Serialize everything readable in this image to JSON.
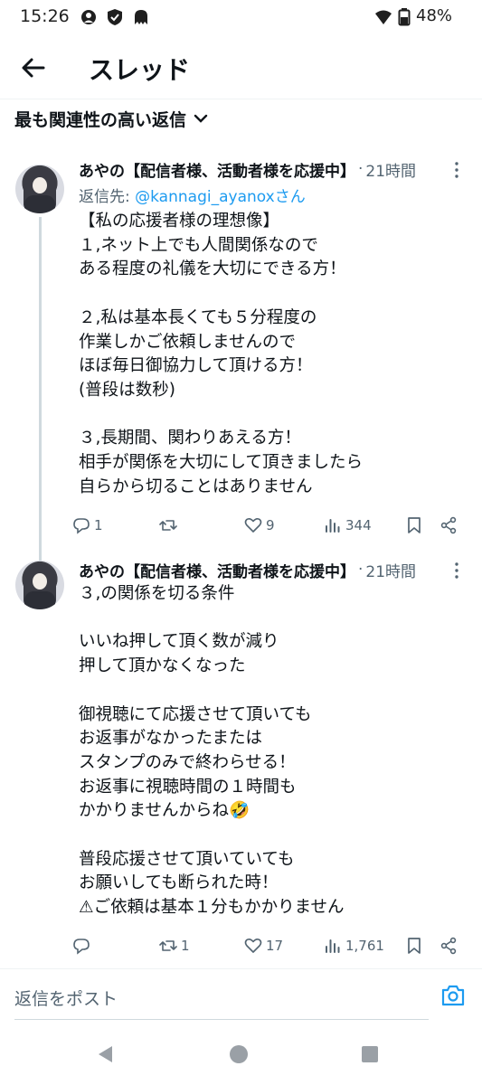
{
  "status_bar": {
    "time": "15:26",
    "battery": "48%",
    "icons": [
      "assistant-icon",
      "shield-icon",
      "app-notification-icon",
      "wifi-icon",
      "battery-icon"
    ]
  },
  "header": {
    "back_icon": "arrow-left-icon",
    "title": "スレッド"
  },
  "sort": {
    "label": "最も関連性の高い返信",
    "icon": "chevron-down-icon"
  },
  "tweets": [
    {
      "author": "あやの【配信者様、活動者様を応援中】",
      "separator": "·",
      "time": "21時間",
      "reply_prefix": "返信先: ",
      "reply_handle": "@kannagi_ayanoxさん",
      "text": "【私の応援者様の理想像】\n１,ネット上でも人間関係なので\nある程度の礼儀を大切にできる方！\n\n２,私は基本長くても５分程度の\n作業しかご依頼しませんので\nほぼ毎日御協力して頂ける方！\n(普段は数秒)\n\n３,長期間、関わりあえる方！\n相手が関係を大切にして頂きましたら\n自らから切ることはありません",
      "replies": "1",
      "retweets": "",
      "likes": "9",
      "views": "344"
    },
    {
      "author": "あやの【配信者様、活動者様を応援中】",
      "separator": "·",
      "time": "21時間",
      "text": "３,の関係を切る条件\n\nいいね押して頂く数が減り\n押して頂かなくなった\n\n御視聴にて応援させて頂いても\nお返事がなかったまたは\nスタンプのみで終わらせる！\nお返事に視聴時間の１時間も\nかかりませんからね🤣\n\n普段応援させて頂いていても\nお願いしても断られた時！\n⚠ご依頼は基本１分もかかりません",
      "replies": "",
      "retweets": "1",
      "likes": "17",
      "views": "1,761"
    }
  ],
  "reply_box": {
    "placeholder": "返信をポスト",
    "camera_icon": "camera-icon"
  },
  "colors": {
    "accent": "#1d9bf0",
    "secondary_text": "#536471",
    "primary_text": "#0f1419",
    "thread_line": "#cfd9de"
  }
}
